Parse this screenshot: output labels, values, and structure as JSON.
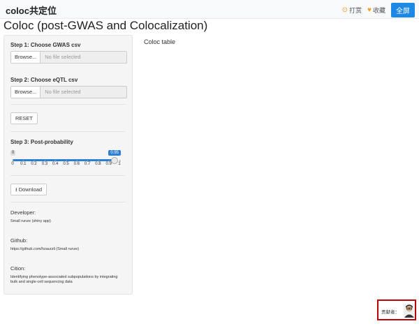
{
  "topbar": {
    "brand": "coloc共定位",
    "links": [
      {
        "label": "打赏",
        "icon": "tip-icon"
      },
      {
        "label": "收藏",
        "icon": "heart-icon"
      }
    ],
    "fullscreen_label": "全屏"
  },
  "page": {
    "title": "Coloc (post-GWAS and Colocalization)"
  },
  "sidebar": {
    "step1_label": "Step 1: Choose GWAS csv",
    "step1_browse": "Browse...",
    "step1_file": "No file selected",
    "step2_label": "Step 2: Choose eQTL csv",
    "step2_browse": "Browse...",
    "step2_file": "No file selected",
    "reset_label": "RESET",
    "step3_label": "Step 3: Post-probability",
    "slider": {
      "min_label": "0",
      "value_label": "0.95",
      "value": 0.95,
      "ticks": [
        "0",
        "0.1",
        "0.2",
        "0.3",
        "0.4",
        "0.5",
        "0.6",
        "0.7",
        "0.8",
        "0.9",
        "1"
      ]
    },
    "download_label": "Download",
    "developer_heading": "Developer:",
    "developer_text": "Small runze (shiny app)",
    "github_heading": "Github:",
    "github_text": "https://github.com/hzaurzli (Small runze)",
    "cition_heading": "Cition:",
    "cition_text": "Identifying phenotype-associated subpopulations by integrating bulk and single-cell sequencing data"
  },
  "main": {
    "coloc_table_label": "Coloc table"
  },
  "contributor": {
    "label": "贡献者："
  },
  "colors": {
    "accent": "#1e88e5",
    "slider": "#2a7ed3",
    "highlight_border": "#c00000"
  }
}
